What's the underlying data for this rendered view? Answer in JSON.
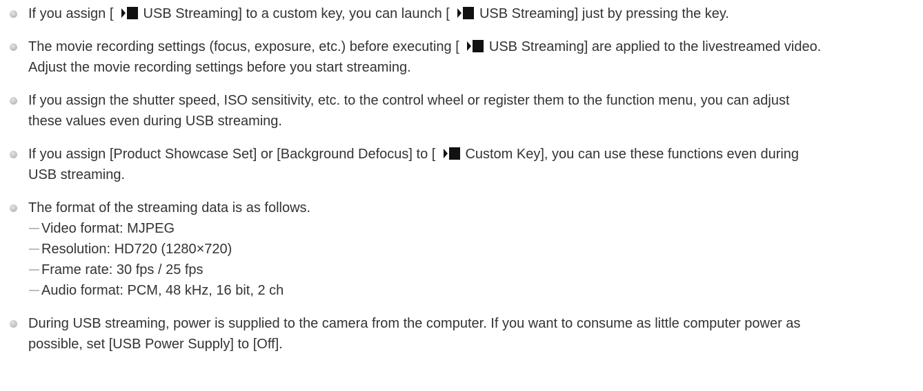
{
  "notes": [
    {
      "lines": [
        [
          "If you assign [",
          {
            "icon": "movie-icon"
          },
          " USB Streaming] to a custom key, you can launch [",
          {
            "icon": "movie-icon"
          },
          " USB Streaming] just by pressing the key."
        ]
      ]
    },
    {
      "lines": [
        [
          "The movie recording settings (focus, exposure, etc.) before executing [",
          {
            "icon": "movie-icon"
          },
          " USB Streaming] are applied to the livestreamed video."
        ],
        [
          "Adjust the movie recording settings before you start streaming."
        ]
      ]
    },
    {
      "lines": [
        [
          "If you assign the shutter speed, ISO sensitivity, etc. to the control wheel or register them to the function menu, you can adjust"
        ],
        [
          "these values even during USB streaming."
        ]
      ]
    },
    {
      "lines": [
        [
          "If you assign [Product Showcase Set] or [Background Defocus] to [",
          {
            "icon": "movie-icon"
          },
          " Custom Key], you can use these functions even during"
        ],
        [
          "USB streaming."
        ]
      ]
    },
    {
      "lines": [
        [
          "The format of the streaming data is as follows."
        ]
      ],
      "sub_items": [
        "Video format: MJPEG",
        "Resolution: HD720 (1280×720)",
        "Frame rate: 30 fps / 25 fps",
        "Audio format: PCM, 48 kHz, 16 bit, 2 ch"
      ]
    },
    {
      "lines": [
        [
          "During USB streaming, power is supplied to the camera from the computer. If you want to consume as little computer power as"
        ],
        [
          "possible, set [USB Power Supply] to [Off]."
        ]
      ]
    }
  ],
  "colors": {
    "text": "#333333",
    "icon": "#111111",
    "bullet": "#c4c4c4",
    "dash": "#bcbcbc"
  }
}
